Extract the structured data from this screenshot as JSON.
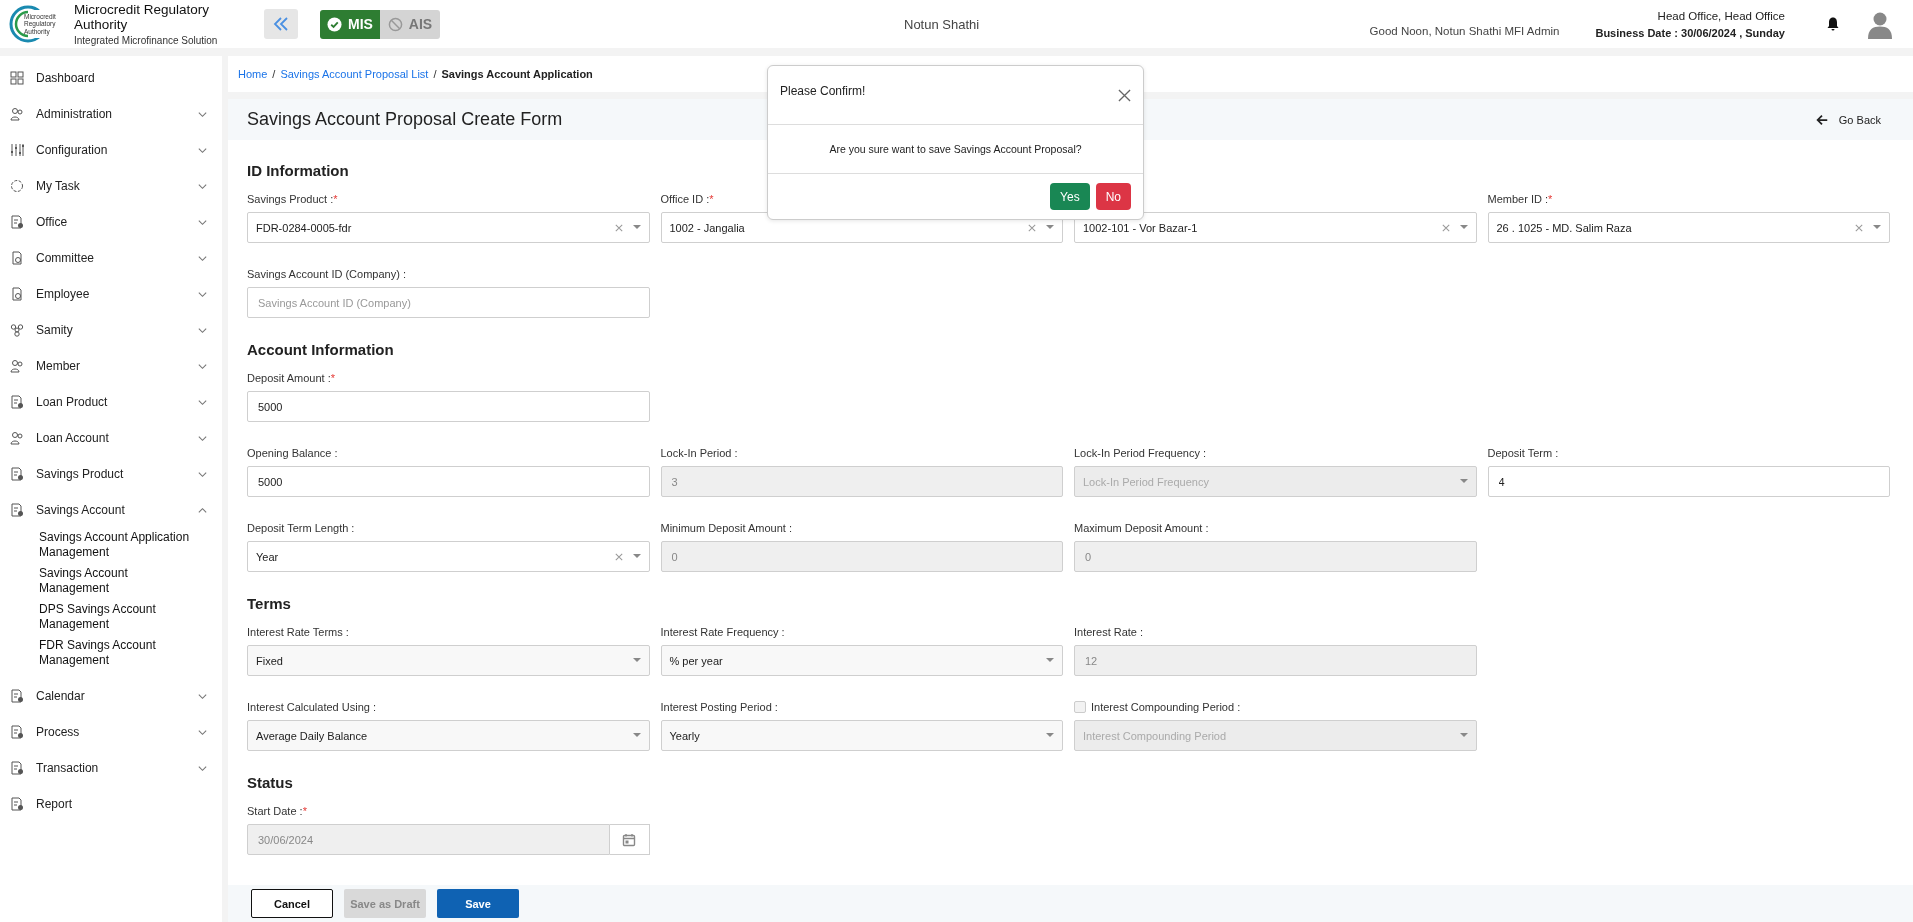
{
  "header": {
    "logo_text": [
      "Microcredit",
      "Regulatory",
      "Authority"
    ],
    "org_name": "Microcredit Regulatory Authority",
    "org_subtitle": "Integrated Microfinance Solution",
    "modules": [
      {
        "label": "MIS",
        "selected": true
      },
      {
        "label": "AIS",
        "selected": false
      }
    ],
    "app_name": "Notun Shathi",
    "greeting": "Good Noon, Notun Shathi MFI Admin",
    "office": "Head Office, Head Office",
    "business_date": "Business Date : 30/06/2024 , Sunday"
  },
  "sidebar": {
    "items": [
      {
        "label": "Dashboard",
        "kind": "link"
      },
      {
        "label": "Administration",
        "kind": "group",
        "expanded": false
      },
      {
        "label": "Configuration",
        "kind": "group",
        "expanded": false
      },
      {
        "label": "My Task",
        "kind": "group",
        "expanded": false
      },
      {
        "label": "Office",
        "kind": "group",
        "expanded": false
      },
      {
        "label": "Committee",
        "kind": "group",
        "expanded": false
      },
      {
        "label": "Employee",
        "kind": "group",
        "expanded": false
      },
      {
        "label": "Samity",
        "kind": "group",
        "expanded": false
      },
      {
        "label": "Member",
        "kind": "group",
        "expanded": false
      },
      {
        "label": "Loan Product",
        "kind": "group",
        "expanded": false
      },
      {
        "label": "Loan Account",
        "kind": "group",
        "expanded": false
      },
      {
        "label": "Savings Product",
        "kind": "group",
        "expanded": false
      },
      {
        "label": "Savings Account",
        "kind": "group",
        "expanded": true,
        "children": [
          {
            "label": "Savings Account Application Management"
          },
          {
            "label": "Savings Account Management"
          },
          {
            "label": "DPS Savings Account Management"
          },
          {
            "label": "FDR Savings Account Management"
          }
        ]
      },
      {
        "label": "Calendar",
        "kind": "group",
        "expanded": false
      },
      {
        "label": "Process",
        "kind": "group",
        "expanded": false
      },
      {
        "label": "Transaction",
        "kind": "group",
        "expanded": false
      },
      {
        "label": "Report",
        "kind": "link"
      }
    ]
  },
  "breadcrumb": {
    "separator": "/",
    "items": [
      {
        "label": "Home",
        "kind": "link"
      },
      {
        "label": "Savings Account Proposal List",
        "kind": "link"
      },
      {
        "label": "Savings Account Application",
        "kind": "current"
      }
    ]
  },
  "form": {
    "title": "Savings Account Proposal Create Form",
    "go_back": "Go Back",
    "sections": [
      {
        "title": "ID Information",
        "rows": [
          [
            {
              "kind": "select",
              "label": "Savings Product :",
              "required_mark": "*",
              "value": "FDR-0284-0005-fdr",
              "clearable": true,
              "disabled": false
            },
            {
              "kind": "select",
              "label": "Office ID :",
              "required_mark": "*",
              "value": "1002 - Jangalia",
              "clearable": true,
              "disabled": false
            },
            {
              "kind": "select",
              "value": "1002-101 - Vor Bazar-1",
              "clearable": true,
              "disabled": false
            },
            {
              "kind": "select",
              "label": "Member ID :",
              "required_mark": "*",
              "value": "26 . 1025 - MD. Salim Raza",
              "clearable": true,
              "disabled": false
            }
          ],
          [
            {
              "kind": "input",
              "label": "Savings Account ID (Company) :",
              "placeholder": "Savings Account ID (Company)",
              "disabled": false
            }
          ]
        ]
      },
      {
        "title": "Account Information",
        "rows": [
          [
            {
              "kind": "input",
              "label": "Deposit Amount :",
              "required_mark": "*",
              "value": "5000",
              "disabled": false
            }
          ],
          [
            {
              "kind": "input",
              "label": "Opening Balance :",
              "value": "5000",
              "disabled": false
            },
            {
              "kind": "input",
              "label": "Lock-In Period :",
              "value": "3",
              "disabled": true
            },
            {
              "kind": "select",
              "label": "Lock-In Period Frequency :",
              "placeholder": "Lock-In Period Frequency",
              "clearable": false,
              "disabled": true
            },
            {
              "kind": "input",
              "label": "Deposit Term :",
              "value": "4",
              "disabled": false
            }
          ],
          [
            {
              "kind": "select",
              "label": "Deposit Term Length :",
              "value": "Year",
              "clearable": true,
              "disabled": false
            },
            {
              "kind": "input",
              "label": "Minimum Deposit Amount :",
              "value": "0",
              "disabled": true
            },
            {
              "kind": "input",
              "label": "Maximum Deposit Amount :",
              "value": "0",
              "disabled": true
            }
          ]
        ]
      },
      {
        "title": "Terms",
        "rows": [
          [
            {
              "kind": "select",
              "label": "Interest Rate Terms :",
              "value": "Fixed",
              "clearable": false,
              "disabled": false
            },
            {
              "kind": "select",
              "label": "Interest Rate Frequency :",
              "value": "% per year",
              "clearable": false,
              "disabled": false
            },
            {
              "kind": "input",
              "label": "Interest Rate :",
              "value": "12",
              "disabled": true
            }
          ],
          [
            {
              "kind": "select",
              "label": "Interest Calculated Using :",
              "value": "Average Daily Balance",
              "clearable": false,
              "disabled": false
            },
            {
              "kind": "select",
              "label": "Interest Posting Period :",
              "value": "Yearly",
              "clearable": false,
              "disabled": false
            },
            {
              "kind": "select",
              "label": "Interest Compounding Period :",
              "checked": false,
              "placeholder": "Interest Compounding Period",
              "clearable": false,
              "disabled": true
            }
          ]
        ]
      },
      {
        "title": "Status",
        "rows": [
          [
            {
              "kind": "date",
              "label": "Start Date :",
              "required_mark": "*",
              "value": "30/06/2024",
              "disabled": true
            }
          ]
        ]
      }
    ],
    "actions": [
      {
        "label": "Cancel",
        "kind": "outline",
        "disabled": false
      },
      {
        "label": "Save as Draft",
        "kind": "draft",
        "disabled": true
      },
      {
        "label": "Save",
        "kind": "primary",
        "disabled": false
      }
    ]
  },
  "dialog": {
    "title": "Please Confirm!",
    "message": "Are you sure want to save Savings Account Proposal?",
    "buttons": [
      {
        "label": "Yes",
        "kind": "confirm"
      },
      {
        "label": "No",
        "kind": "cancel"
      }
    ]
  }
}
